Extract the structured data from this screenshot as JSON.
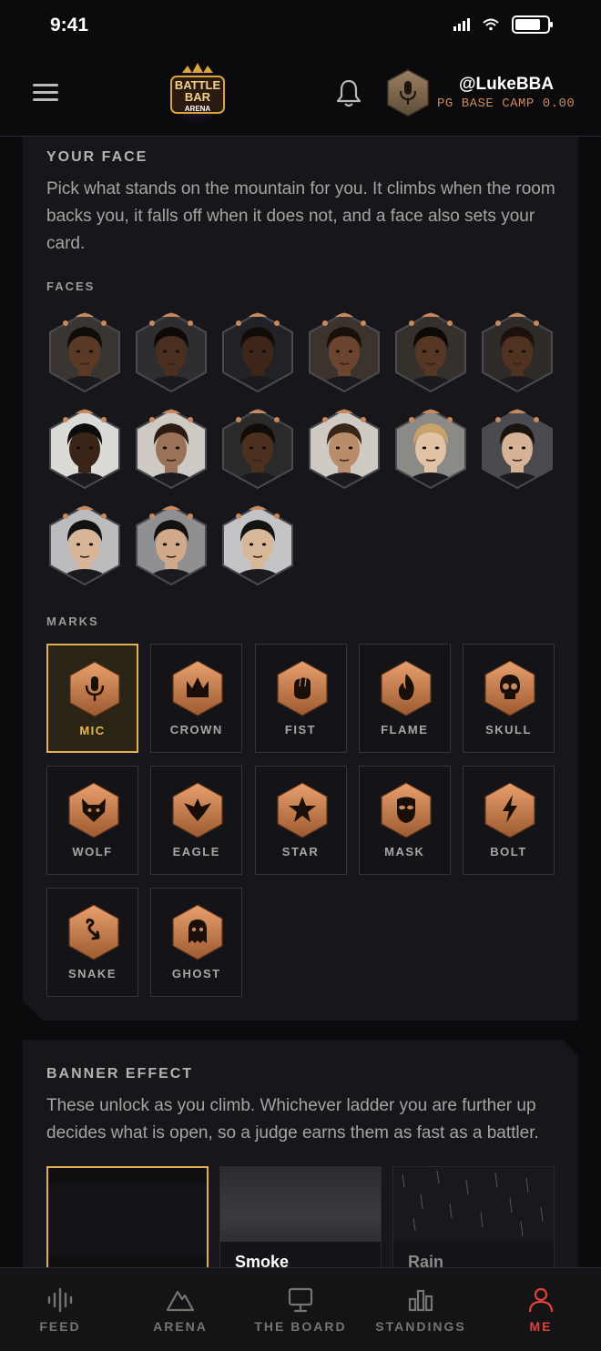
{
  "status_bar": {
    "time": "9:41"
  },
  "header": {
    "logo_text": [
      "BATTLE",
      "BAR",
      "ARENA"
    ],
    "username": "@LukeBBA",
    "rank": "PG BASE CAMP 0.00",
    "icons": [
      "menu-icon",
      "bell-icon",
      "mic-avatar-icon"
    ]
  },
  "your_face": {
    "title": "YOUR FACE",
    "description": "Pick what stands on the mountain for you. It climbs when the room backs you, it falls off when it does not, and a face also sets your card.",
    "faces_label": "FACES",
    "face_count": 15,
    "marks_label": "MARKS",
    "marks": [
      {
        "label": "MIC",
        "icon": "mic-icon",
        "selected": true
      },
      {
        "label": "CROWN",
        "icon": "crown-icon",
        "selected": false
      },
      {
        "label": "FIST",
        "icon": "fist-icon",
        "selected": false
      },
      {
        "label": "FLAME",
        "icon": "flame-icon",
        "selected": false
      },
      {
        "label": "SKULL",
        "icon": "skull-icon",
        "selected": false
      },
      {
        "label": "WOLF",
        "icon": "wolf-icon",
        "selected": false
      },
      {
        "label": "EAGLE",
        "icon": "eagle-icon",
        "selected": false
      },
      {
        "label": "STAR",
        "icon": "star-icon",
        "selected": false
      },
      {
        "label": "MASK",
        "icon": "mask-icon",
        "selected": false
      },
      {
        "label": "BOLT",
        "icon": "bolt-icon",
        "selected": false
      },
      {
        "label": "SNAKE",
        "icon": "snake-icon",
        "selected": false
      },
      {
        "label": "GHOST",
        "icon": "ghost-icon",
        "selected": false
      }
    ]
  },
  "banner_effect": {
    "title": "BANNER EFFECT",
    "description": "These unlock as you climb. Whichever ladder you are further up decides what is open, so a judge earns them as fast as a battler.",
    "effects": [
      {
        "label": "",
        "selected": true
      },
      {
        "label": "Smoke",
        "selected": false
      },
      {
        "label": "Rain",
        "selected": false
      }
    ]
  },
  "bottom_nav": [
    {
      "label": "FEED",
      "icon": "feed-icon",
      "active": false
    },
    {
      "label": "ARENA",
      "icon": "arena-mountain-icon",
      "active": false
    },
    {
      "label": "THE BOARD",
      "icon": "board-monitor-icon",
      "active": false
    },
    {
      "label": "STANDINGS",
      "icon": "standings-chart-icon",
      "active": false
    },
    {
      "label": "ME",
      "icon": "profile-icon",
      "active": true
    }
  ],
  "colors": {
    "accent_copper": "#c9895f",
    "selected_gold": "#e3b24e",
    "active_red": "#e0413a",
    "card_bg": "#17171b"
  }
}
